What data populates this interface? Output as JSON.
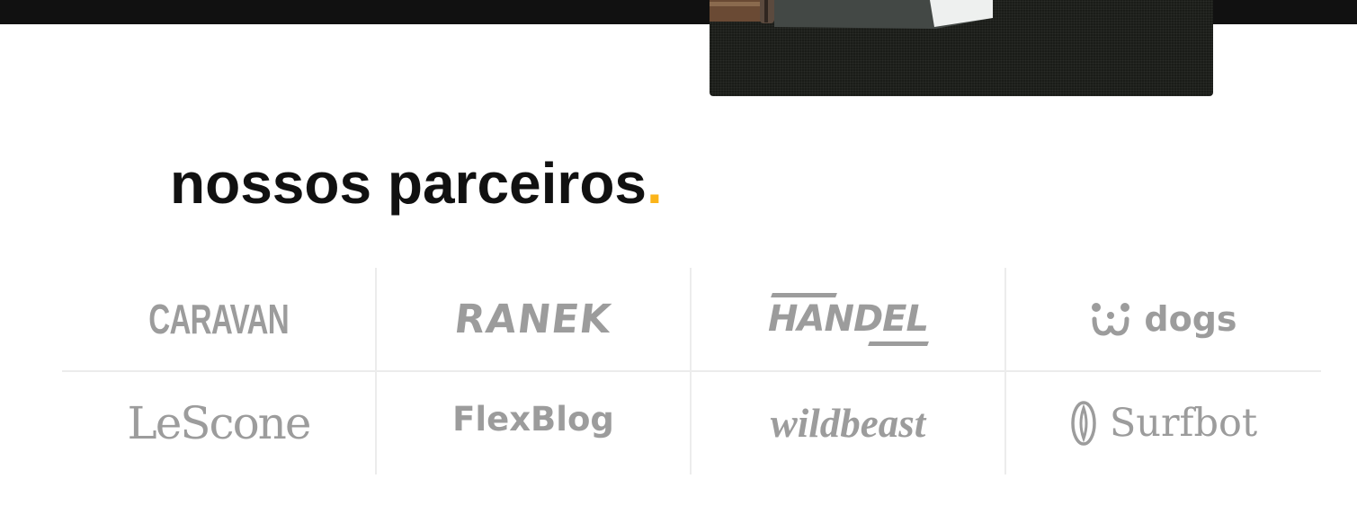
{
  "section": {
    "title": "nossos parceiros",
    "title_accent": ".",
    "accent_color": "#fbb419"
  },
  "partners": [
    {
      "name": "CARAVAN"
    },
    {
      "name": "RANEK"
    },
    {
      "name": "HANDEL"
    },
    {
      "name": "dogs",
      "icon": "dog-face-icon"
    },
    {
      "name": "LeScone"
    },
    {
      "name": "FlexBlog"
    },
    {
      "name": "wildbeast"
    },
    {
      "name": "Surfbot",
      "icon": "surfboard-icon"
    }
  ],
  "colors": {
    "topbar": "#111111",
    "logo_gray": "#9c9c9c",
    "grid_line": "#ececec",
    "title_text": "#111111"
  }
}
